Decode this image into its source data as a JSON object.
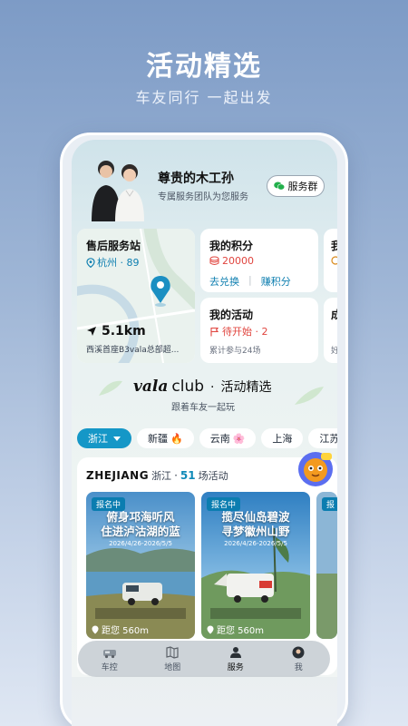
{
  "hero": {
    "title": "活动精选",
    "subtitle": "车友同行 一起出发"
  },
  "header": {
    "user_name": "尊贵的木工孙",
    "user_sub": "专属服务团队为您服务",
    "service_button": "服务群"
  },
  "station": {
    "title": "售后服务站",
    "city": "杭州 · 89",
    "distance": "5.1km",
    "address": "西溪首座B3vala总部超..."
  },
  "points": {
    "title": "我的积分",
    "value": "20000",
    "link_exchange": "去兑换",
    "link_earn": "赚积分"
  },
  "activity": {
    "title": "我的活动",
    "status": "待开始 · 2",
    "footer": "累计参与24场"
  },
  "side_cards": {
    "top_label": "我",
    "bottom_label": "成",
    "bottom_sub": "好"
  },
  "club": {
    "brand": "vala",
    "word": "club",
    "sep": "·",
    "section": "活动精选",
    "subtitle": "跟着车友一起玩"
  },
  "regions": [
    {
      "label": "浙江",
      "active": true,
      "emoji": ""
    },
    {
      "label": "新疆",
      "active": false,
      "emoji": "🔥"
    },
    {
      "label": "云南",
      "active": false,
      "emoji": "🌸"
    },
    {
      "label": "上海",
      "active": false,
      "emoji": ""
    },
    {
      "label": "江苏",
      "active": false,
      "emoji": ""
    }
  ],
  "panel": {
    "region_en": "ZHEJIANG",
    "region_zh": "浙江",
    "count": "51",
    "unit": "场活动"
  },
  "activities": [
    {
      "badge": "报名中",
      "title_line1": "俯身邛海听风",
      "title_line2": "住进泸沽湖的蓝",
      "date": "2026/4/26-2026/5/5",
      "distance": "距您 560m"
    },
    {
      "badge": "报名中",
      "title_line1": "揽尽仙岛碧波",
      "title_line2": "寻梦徽州山野",
      "date": "2026/4/26-2026/5/5",
      "distance": "距您 560m"
    },
    {
      "badge": "报"
    }
  ],
  "nav": [
    {
      "label": "车控",
      "icon": "car-icon",
      "active": false
    },
    {
      "label": "地图",
      "icon": "map-icon",
      "active": false
    },
    {
      "label": "服务",
      "icon": "service-icon",
      "active": true
    },
    {
      "label": "我",
      "icon": "profile-icon",
      "active": false
    }
  ],
  "colors": {
    "accent": "#1597c7",
    "points_red": "#e0443e"
  }
}
